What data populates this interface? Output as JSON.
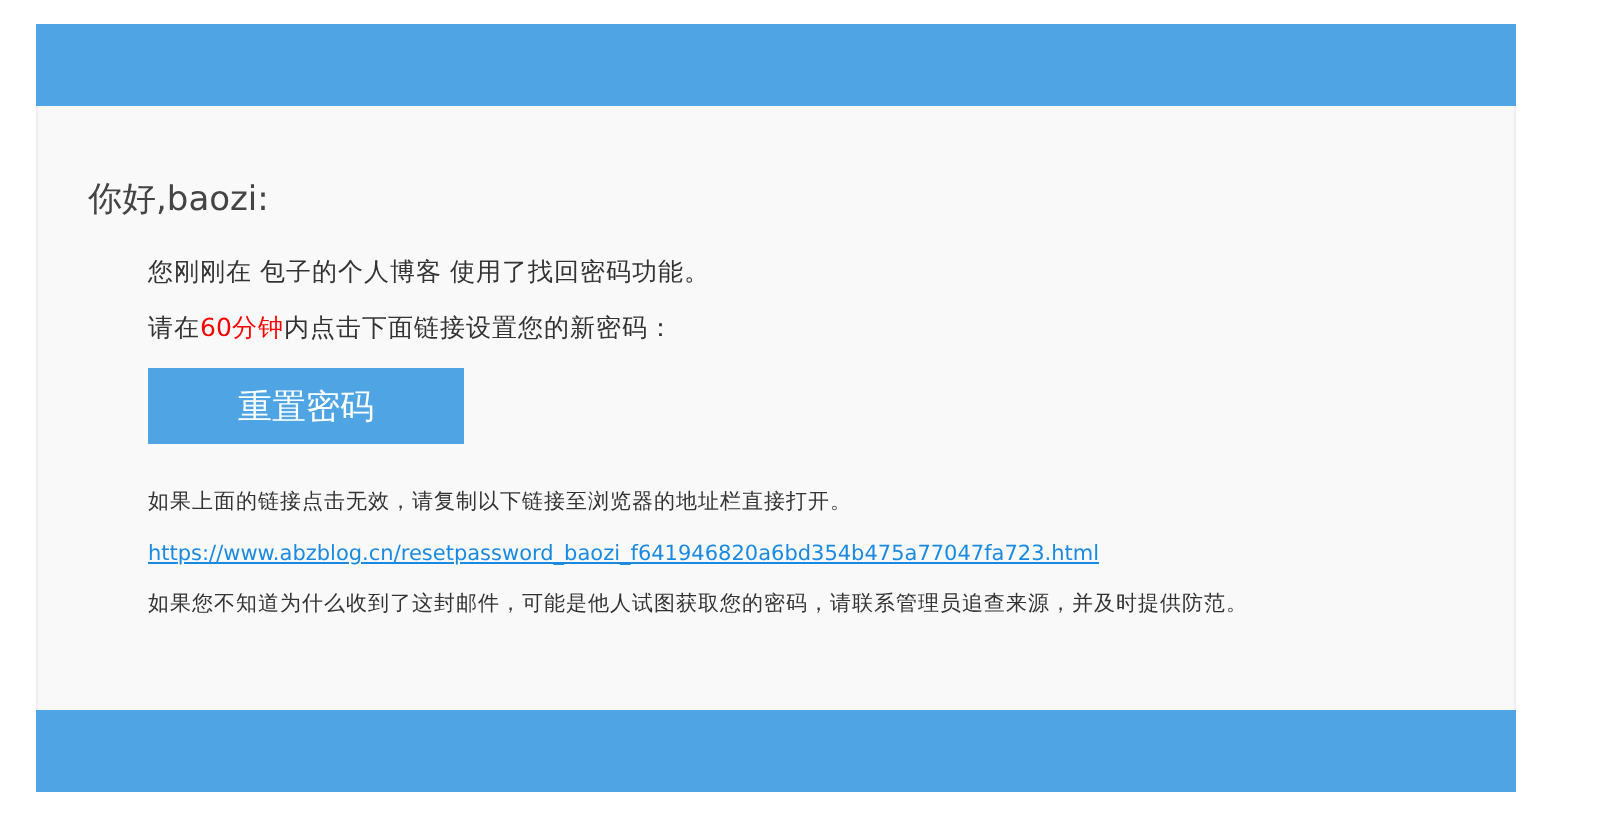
{
  "greeting": "你好,baozi:",
  "intro": "您刚刚在 包子的个人博客 使用了找回密码功能。",
  "deadline": {
    "before": "请在",
    "highlight": "60分钟",
    "after": "内点击下面链接设置您的新密码："
  },
  "reset_button": "重置密码",
  "fallback_note": "如果上面的链接点击无效，请复制以下链接至浏览器的地址栏直接打开。",
  "reset_link": "https://www.abzblog.cn/resetpassword_baozi_f641946820a6bd354b475a77047fa723.html",
  "warning_note": "如果您不知道为什么收到了这封邮件，可能是他人试图获取您的密码，请联系管理员追查来源，并及时提供防范。"
}
